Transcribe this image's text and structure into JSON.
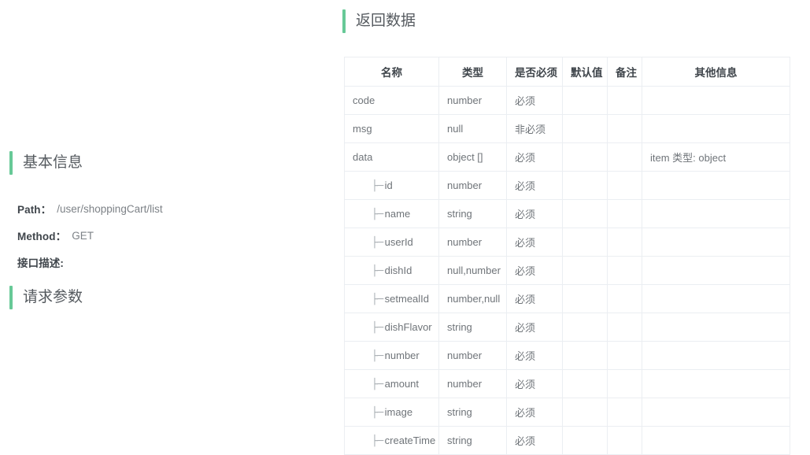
{
  "theme": {
    "accent_color": "#67c997",
    "heading_color": "#555a5f",
    "body_text_color": "#6f7479",
    "border_color": "#ebeef2"
  },
  "left_panel": {
    "basic_info": {
      "heading": "基本信息",
      "rows": [
        {
          "label": "Path：",
          "value": "/user/shoppingCart/list"
        },
        {
          "label": "Method：",
          "value": "GET"
        },
        {
          "label": "接口描述:",
          "value": ""
        }
      ]
    },
    "request_params": {
      "heading": "请求参数"
    }
  },
  "right_panel": {
    "return_data": {
      "heading": "返回数据",
      "table": {
        "columns": [
          "名称",
          "类型",
          "是否必须",
          "默认值",
          "备注",
          "其他信息"
        ],
        "rows": [
          {
            "indent": 0,
            "prefix": "",
            "name": "code",
            "type": "number",
            "required": "必须",
            "default": "",
            "remark": "",
            "extra": ""
          },
          {
            "indent": 0,
            "prefix": "",
            "name": "msg",
            "type": "null",
            "required": "非必须",
            "default": "",
            "remark": "",
            "extra": ""
          },
          {
            "indent": 0,
            "prefix": "",
            "name": "data",
            "type": "object []",
            "required": "必须",
            "default": "",
            "remark": "",
            "extra": "item 类型: object"
          },
          {
            "indent": 1,
            "prefix": "├─",
            "name": "id",
            "type": "number",
            "required": "必须",
            "default": "",
            "remark": "",
            "extra": ""
          },
          {
            "indent": 1,
            "prefix": "├─",
            "name": "name",
            "type": "string",
            "required": "必须",
            "default": "",
            "remark": "",
            "extra": ""
          },
          {
            "indent": 1,
            "prefix": "├─",
            "name": "userId",
            "type": "number",
            "required": "必须",
            "default": "",
            "remark": "",
            "extra": ""
          },
          {
            "indent": 1,
            "prefix": "├─",
            "name": "dishId",
            "type": "null,number",
            "required": "必须",
            "default": "",
            "remark": "",
            "extra": ""
          },
          {
            "indent": 1,
            "prefix": "├─",
            "name": "setmealId",
            "type": "number,null",
            "required": "必须",
            "default": "",
            "remark": "",
            "extra": ""
          },
          {
            "indent": 1,
            "prefix": "├─",
            "name": "dishFlavor",
            "type": "string",
            "required": "必须",
            "default": "",
            "remark": "",
            "extra": ""
          },
          {
            "indent": 1,
            "prefix": "├─",
            "name": "number",
            "type": "number",
            "required": "必须",
            "default": "",
            "remark": "",
            "extra": ""
          },
          {
            "indent": 1,
            "prefix": "├─",
            "name": "amount",
            "type": "number",
            "required": "必须",
            "default": "",
            "remark": "",
            "extra": ""
          },
          {
            "indent": 1,
            "prefix": "├─",
            "name": "image",
            "type": "string",
            "required": "必须",
            "default": "",
            "remark": "",
            "extra": ""
          },
          {
            "indent": 1,
            "prefix": "├─",
            "name": "createTime",
            "type": "string",
            "required": "必须",
            "default": "",
            "remark": "",
            "extra": ""
          }
        ]
      }
    }
  }
}
